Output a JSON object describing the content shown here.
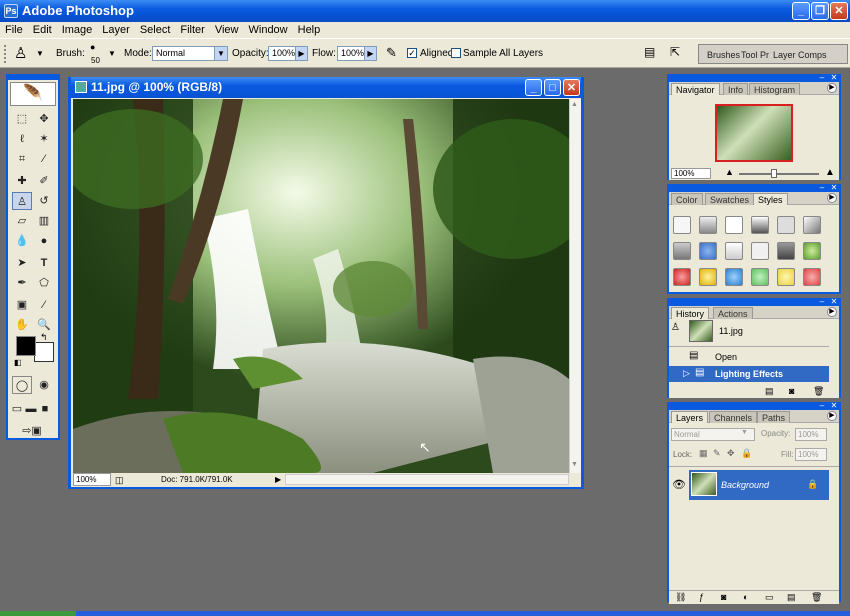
{
  "app": {
    "title": "Adobe Photoshop"
  },
  "menu": [
    "File",
    "Edit",
    "Image",
    "Layer",
    "Select",
    "Filter",
    "View",
    "Window",
    "Help"
  ],
  "options": {
    "brush_label": "Brush:",
    "brush_size": "50",
    "mode_label": "Mode:",
    "mode_value": "Normal",
    "opacity_label": "Opacity:",
    "opacity_value": "100%",
    "flow_label": "Flow:",
    "flow_value": "100%",
    "aligned_label": "Aligned",
    "aligned_checked": true,
    "sample_all_label": "Sample All Layers",
    "sample_all_checked": false
  },
  "palette_well": [
    "Brushes",
    "Tool Pr",
    "Layer Comps"
  ],
  "document": {
    "title": "11.jpg @ 100% (RGB/8)",
    "zoom": "100%",
    "doc_info": "Doc: 791.0K/791.0K"
  },
  "navigator": {
    "tabs": [
      "Navigator",
      "Info",
      "Histogram"
    ],
    "zoom": "100%"
  },
  "color_panel": {
    "tabs": [
      "Color",
      "Swatches",
      "Styles"
    ]
  },
  "history": {
    "tabs": [
      "History",
      "Actions"
    ],
    "snapshot": "11.jpg",
    "items": [
      "Open",
      "Lighting Effects"
    ]
  },
  "layers": {
    "tabs": [
      "Layers",
      "Channels",
      "Paths"
    ],
    "blend_mode": "Normal",
    "opacity_label": "Opacity:",
    "opacity_value": "100%",
    "lock_label": "Lock:",
    "fill_label": "Fill:",
    "fill_value": "100%",
    "layer_name": "Background"
  },
  "colors": {
    "xp_blue": "#0a5ae0",
    "selection": "#316ac5",
    "panel_bg": "#ece9d8"
  }
}
